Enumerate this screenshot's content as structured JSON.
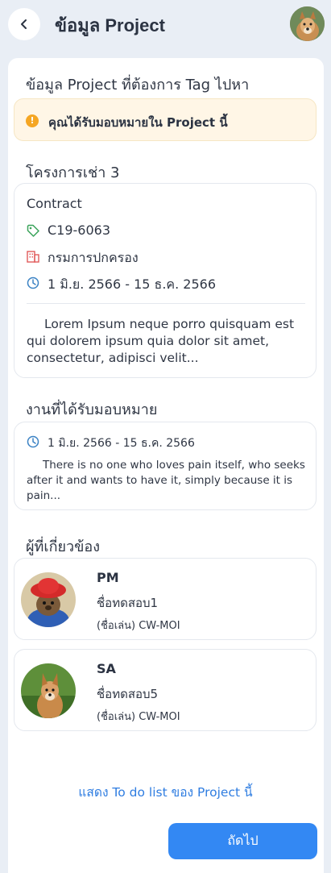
{
  "header": {
    "title": "ข้อมูล Project",
    "back_icon": "chevron-left-icon",
    "avatar": "user-avatar-dog"
  },
  "intro_heading": "ข้อมูล Project ที่ต้องการ Tag ไปหา",
  "alert": {
    "icon": "info-icon",
    "text": "คุณได้รับมอบหมายใน Project นี้",
    "color": "#f5a623"
  },
  "project": {
    "name": "โครงการเช่า 3",
    "type": "Contract",
    "code": "C19-6063",
    "department": "กรมการปกครอง",
    "period": "1 มิ.ย. 2566 - 15 ธ.ค. 2566",
    "description": "Lorem Ipsum neque porro quisquam est qui dolorem ipsum quia dolor sit amet, consectetur, adipisci velit..."
  },
  "assignment": {
    "heading": "งานที่ได้รับมอบหมาย",
    "period": "1 มิ.ย. 2566 - 15 ธ.ค. 2566",
    "description": "There is no one who loves pain itself, who seeks after it and wants to have it, simply because it is pain..."
  },
  "related": {
    "heading": "ผู้ที่เกี่ยวข้อง",
    "people": [
      {
        "role": "PM",
        "name": "ชื่อทดสอบ1",
        "nickname": "(ชื่อเล่น) CW-MOI"
      },
      {
        "role": "SA",
        "name": "ชื่อทดสอบ5",
        "nickname": "(ชื่อเล่น) CW-MOI"
      }
    ]
  },
  "todo_link": "แสดง To do list ของ Project นี้",
  "next_button": "ถัดไป",
  "colors": {
    "accent": "#3388f3",
    "link": "#2f7de1",
    "tag_icon": "#3aa35a",
    "building_icon": "#e05a5a",
    "clock_icon": "#3b82c4"
  }
}
